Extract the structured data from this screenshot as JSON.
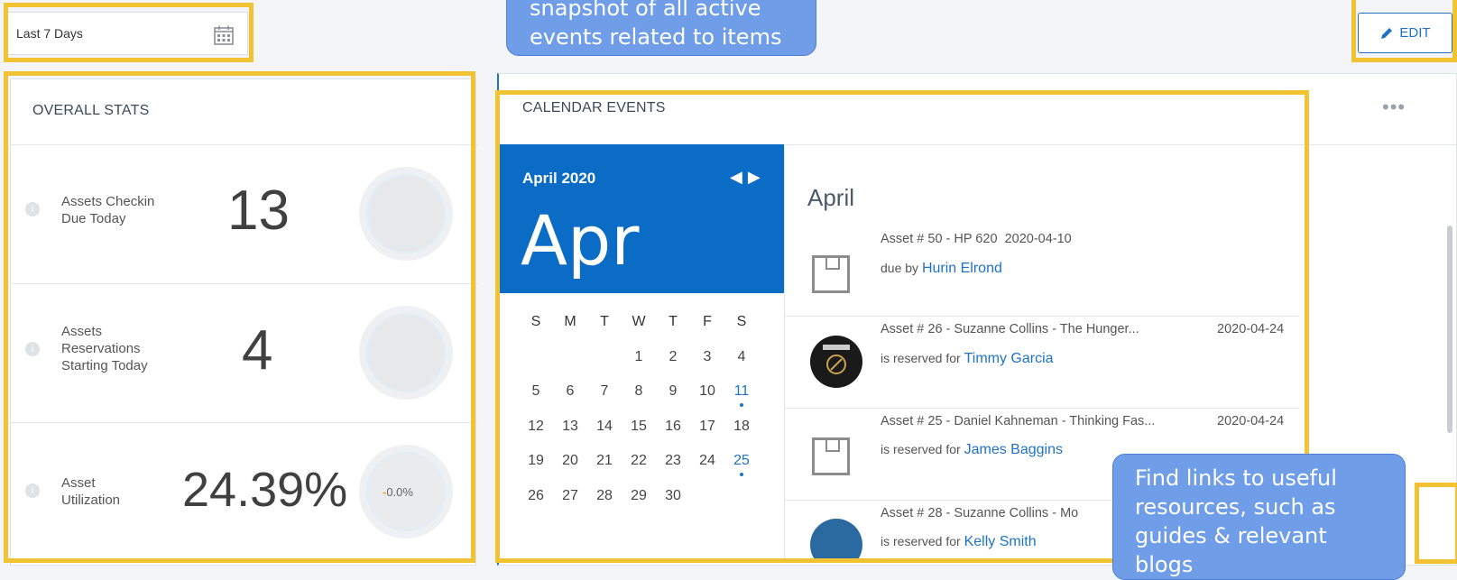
{
  "filter": {
    "date_range": "Last 7 Days",
    "calendar_icon": "calendar-icon"
  },
  "toolbar": {
    "edit_label": "EDIT",
    "edit_icon": "pencil-icon"
  },
  "stats": {
    "title": "OVERALL STATS",
    "items": [
      {
        "label_line1": "Assets Checkin",
        "label_line2": "Due Today",
        "value": "13"
      },
      {
        "label_line1": "Assets",
        "label_line2": "Reservations",
        "label_line3": "Starting Today",
        "value": "4"
      },
      {
        "label_line1": "Asset",
        "label_line2": "Utilization",
        "value": "24.39%",
        "change": "0.0%"
      }
    ]
  },
  "calendar": {
    "title": "CALENDAR EVENTS",
    "month_year": "April 2020",
    "big_month": "Apr",
    "weekdays": [
      "S",
      "M",
      "T",
      "W",
      "T",
      "F",
      "S"
    ],
    "weeks": [
      [
        "",
        "",
        "",
        "1",
        "2",
        "3",
        "4"
      ],
      [
        "5",
        "6",
        "7",
        "8",
        "9",
        "10",
        "11"
      ],
      [
        "12",
        "13",
        "14",
        "15",
        "16",
        "17",
        "18"
      ],
      [
        "19",
        "20",
        "21",
        "22",
        "23",
        "24",
        "25"
      ],
      [
        "26",
        "27",
        "28",
        "29",
        "30",
        "",
        ""
      ]
    ],
    "event_days": [
      "11",
      "25"
    ],
    "events_month": "April",
    "events": [
      {
        "title": "Asset # 50 - HP 620",
        "date": "2020-04-10",
        "prefix": "due by",
        "person": "Hurin Elrond",
        "thumb": "box"
      },
      {
        "title": "Asset # 26 - Suzanne Collins - The Hunger...",
        "date": "2020-04-24",
        "prefix": "is reserved for",
        "person": "Timmy Garcia",
        "thumb": "book"
      },
      {
        "title": "Asset # 25 - Daniel Kahneman - Thinking Fas...",
        "date": "2020-04-24",
        "prefix": "is reserved for",
        "person": "James Baggins",
        "thumb": "box"
      },
      {
        "title": "Asset # 28 - Suzanne Collins - Mo",
        "date": "",
        "prefix": "is reserved for",
        "person": "Kelly Smith",
        "thumb": "book"
      }
    ]
  },
  "callouts": {
    "calendar_line1": "snapshot of all active",
    "calendar_line2": "events related to items",
    "resources_line1": "Find links to useful",
    "resources_line2": "resources, such as",
    "resources_line3": "guides & relevant",
    "resources_line4": "blogs"
  },
  "colors": {
    "accent": "#1f73c7",
    "highlight": "#f1c232",
    "callout": "#6f9de8",
    "calendar_header": "#0a6cc4"
  }
}
